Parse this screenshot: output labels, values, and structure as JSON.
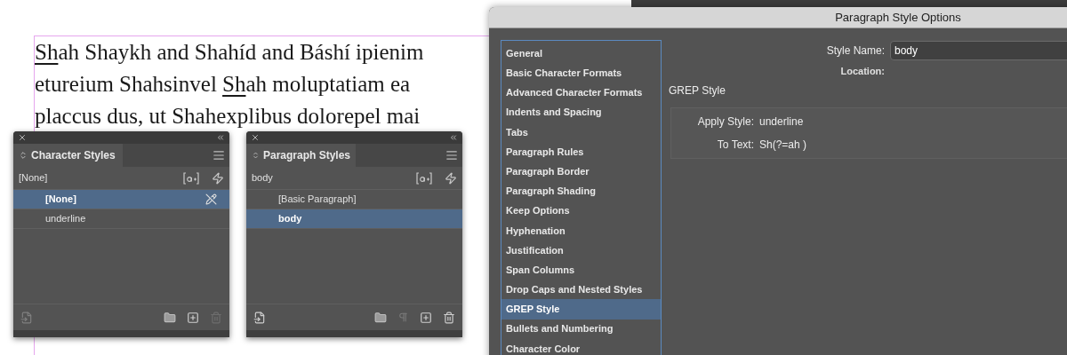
{
  "document": {
    "lines": [
      {
        "segments": [
          {
            "text": "Sh",
            "underline": true
          },
          {
            "text": "ah Shaykh and Shahíd and Báshí ipienim",
            "underline": false
          }
        ]
      },
      {
        "segments": [
          {
            "text": "etureium Shahsinvel ",
            "underline": false
          },
          {
            "text": "Sh",
            "underline": true
          },
          {
            "text": "ah moluptatiam ea",
            "underline": false
          }
        ]
      },
      {
        "segments": [
          {
            "text": "placcus dus, ut Shahexplibus dolorepel mai",
            "underline": false
          }
        ]
      }
    ]
  },
  "panels": [
    {
      "kind": "character",
      "title": "Character Styles",
      "current": "[None]",
      "delete_disabled": true,
      "items": [
        {
          "label": "[None]",
          "selected": true
        },
        {
          "label": "underline",
          "selected": false
        }
      ]
    },
    {
      "kind": "paragraph",
      "title": "Paragraph Styles",
      "current": "body",
      "delete_disabled": false,
      "items": [
        {
          "label": "[Basic Paragraph]",
          "selected": false
        },
        {
          "label": "body",
          "selected": true
        }
      ]
    }
  ],
  "dialog": {
    "title": "Paragraph Style Options",
    "categories": [
      {
        "label": "General",
        "selected": false
      },
      {
        "label": "Basic Character Formats",
        "selected": false
      },
      {
        "label": "Advanced Character Formats",
        "selected": false
      },
      {
        "label": "Indents and Spacing",
        "selected": false
      },
      {
        "label": "Tabs",
        "selected": false
      },
      {
        "label": "Paragraph Rules",
        "selected": false
      },
      {
        "label": "Paragraph Border",
        "selected": false
      },
      {
        "label": "Paragraph Shading",
        "selected": false
      },
      {
        "label": "Keep Options",
        "selected": false
      },
      {
        "label": "Hyphenation",
        "selected": false
      },
      {
        "label": "Justification",
        "selected": false
      },
      {
        "label": "Span Columns",
        "selected": false
      },
      {
        "label": "Drop Caps and Nested Styles",
        "selected": false
      },
      {
        "label": "GREP Style",
        "selected": true
      },
      {
        "label": "Bullets and Numbering",
        "selected": false
      },
      {
        "label": "Character Color",
        "selected": false
      }
    ],
    "style_name_label": "Style Name:",
    "style_name": "body",
    "location_label": "Location:",
    "section_title": "GREP Style",
    "rule": [
      {
        "label": "Apply Style:",
        "value": "underline"
      },
      {
        "label": "To Text:",
        "value": "Sh(?=ah )"
      }
    ]
  }
}
